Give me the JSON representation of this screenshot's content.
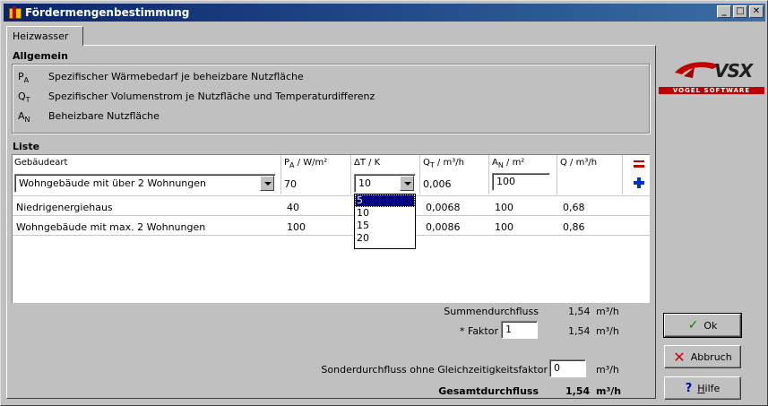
{
  "window": {
    "title": "Fördermengenbestimmung",
    "minimize": "_",
    "maximize": "□",
    "close": "✕"
  },
  "tab": {
    "label": "Heizwasser"
  },
  "allgemein": {
    "title": "Allgemein",
    "defs": [
      {
        "sym": "P",
        "sub": "A",
        "text": "Spezifischer Wärmebedarf je beheizbare Nutzfläche"
      },
      {
        "sym": "Q",
        "sub": "T",
        "text": "Spezifischer Volumenstrom je Nutzfläche und Temperaturdifferenz"
      },
      {
        "sym": "A",
        "sub": "N",
        "text": "Beheizbare Nutzfläche"
      }
    ]
  },
  "liste": {
    "title": "Liste",
    "headers": {
      "gebaeudeart": "Gebäudeart",
      "pa_sym": "P",
      "pa_sub": "A",
      "pa_unit": "/ W/m²",
      "dt": "ΔT / K",
      "qt_sym": "Q",
      "qt_sub": "T",
      "qt_unit": "/ m³/h",
      "an_sym": "A",
      "an_sub": "N",
      "an_unit": "/ m²",
      "q": "Q / m³/h"
    },
    "input_row": {
      "gebaeudeart": "Wohngebäude mit über 2 Wohnungen",
      "pa": "70",
      "dt": "10",
      "qt": "0,006",
      "an": "100"
    },
    "rows": [
      {
        "gebaeudeart": "Niedrigenergiehaus",
        "pa": "40",
        "qt": "0,0068",
        "an": "100",
        "q": "0,68"
      },
      {
        "gebaeudeart": "Wohngebäude mit max. 2 Wohnungen",
        "pa": "100",
        "qt": "0,0086",
        "an": "100",
        "q": "0,86"
      }
    ],
    "dt_options": [
      "5",
      "10",
      "15",
      "20"
    ],
    "dt_highlighted": "5"
  },
  "summary": {
    "summen_label": "Summendurchfluss",
    "summen_value": "1,54",
    "summen_unit": "m³/h",
    "faktor_label": "* Faktor",
    "faktor_input": "1",
    "faktor_value": "1,54",
    "faktor_unit": "m³/h",
    "sonder_label": "Sonderdurchfluss ohne Gleichzeitigkeitsfaktor",
    "sonder_input": "0",
    "sonder_unit": "m³/h",
    "gesamt_label": "Gesamtdurchfluss",
    "gesamt_value": "1,54",
    "gesamt_unit": "m³/h"
  },
  "buttons": {
    "ok": "Ok",
    "abbruch": "Abbruch",
    "hilfe_underlined": "H",
    "hilfe_rest": "ilfe"
  },
  "logo": {
    "mark": "VSX",
    "company": "VOGEL SOFTWARE"
  }
}
